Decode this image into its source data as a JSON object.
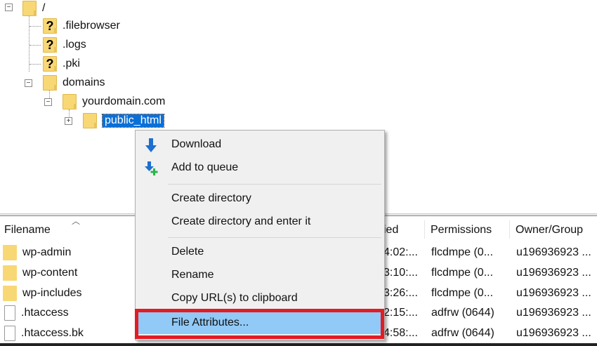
{
  "tree": {
    "root": "/",
    "children": [
      ".filebrowser",
      ".logs",
      ".pki"
    ],
    "domains": "domains",
    "domain": "yourdomain.com",
    "selected": "public_html"
  },
  "context_menu": {
    "items": [
      "Download",
      "Add to queue",
      "Create directory",
      "Create directory and enter it",
      "Delete",
      "Rename",
      "Copy URL(s) to clipboard",
      "File Attributes..."
    ],
    "highlighted": "File Attributes..."
  },
  "file_list": {
    "columns": {
      "filename": "Filename",
      "modified": "ied",
      "permissions": "Permissions",
      "owner": "Owner/Group"
    },
    "rows": [
      {
        "name": "wp-admin",
        "type": "folder",
        "modified": "4:02:...",
        "permissions": "flcdmpe (0...",
        "owner": "u196936923 ..."
      },
      {
        "name": "wp-content",
        "type": "folder",
        "modified": "3:10:...",
        "permissions": "flcdmpe (0...",
        "owner": "u196936923 ..."
      },
      {
        "name": "wp-includes",
        "type": "folder",
        "modified": "3:26:...",
        "permissions": "flcdmpe (0...",
        "owner": "u196936923 ..."
      },
      {
        "name": ".htaccess",
        "type": "file",
        "modified": "2:15:...",
        "permissions": "adfrw (0644)",
        "owner": "u196936923 ..."
      },
      {
        "name": ".htaccess.bk",
        "type": "file",
        "modified": "4:58:...",
        "permissions": "adfrw (0644)",
        "owner": "u196936923 ..."
      }
    ]
  },
  "colors": {
    "selection": "#0a70d8",
    "menu_highlight": "#91c9f7",
    "annotation": "#e31b23"
  }
}
